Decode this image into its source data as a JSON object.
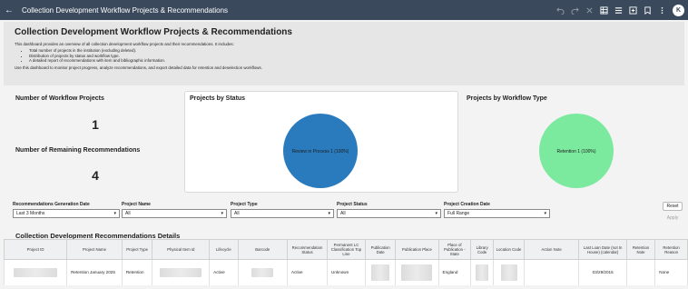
{
  "header": {
    "back_glyph": "←",
    "title": "Collection Development Workflow Projects & Recommendations",
    "avatar_initial": "K"
  },
  "intro": {
    "heading": "Collection Development Workflow Projects & Recommendations",
    "lead": "This dashboard provides an overview of all collection development workflow projects and their recommendations. It includes:",
    "bullets": [
      "Total number of projects in the institution (excluding deleted).",
      "Distribution of projects by status and workflow type.",
      "A detailed report of recommendations with item and bibliographic information."
    ],
    "footer": "Use this dashboard to monitor project progress, analyze recommendations, and export detailed data for retention and deselection workflows."
  },
  "kpis": {
    "projects_title": "Number of Workflow Projects",
    "projects_value": "1",
    "remaining_title": "Number of Remaining Recommendations",
    "remaining_value": "4"
  },
  "status_chart": {
    "title": "Projects by Status",
    "chart_data": {
      "type": "pie",
      "categories": [
        "Review in Process"
      ],
      "values": [
        1
      ],
      "labels": [
        "Review in Process 1 (100%)"
      ],
      "colors": [
        "#2a7bbd"
      ]
    }
  },
  "type_chart": {
    "title": "Projects by Workflow Type",
    "chart_data": {
      "type": "pie",
      "categories": [
        "Retention"
      ],
      "values": [
        1
      ],
      "labels": [
        "Retention 1 (100%)"
      ],
      "colors": [
        "#7bea9f"
      ]
    }
  },
  "filters": {
    "generation_date": {
      "label": "Recommendations Generation Date",
      "value": "Last 3 Months"
    },
    "project_name": {
      "label": "Project Name",
      "value": "All"
    },
    "project_type": {
      "label": "Project Type",
      "value": "All"
    },
    "project_status": {
      "label": "Project Status",
      "value": "All"
    },
    "creation_date": {
      "label": "Project Creation Date",
      "value": "Full Range"
    },
    "caret": "▾",
    "reset_label": "Reset",
    "apply_label": "Apply"
  },
  "details": {
    "title": "Collection Development Recommendations Details",
    "columns": [
      "Project ID",
      "Project Name",
      "Project Type",
      "Physical Item Id",
      "Lifecycle",
      "Barcode",
      "Recommendation Status",
      "Permanent LC Classification Top Line",
      "Publication Date",
      "Publication Place",
      "Place of Publication - State",
      "Library Code",
      "Location Code",
      "Action Note",
      "Last Loan Date (not In House) (calendar)",
      "Retention Note",
      "Retention Reason"
    ],
    "row": {
      "project_name": "Retention January 2025",
      "project_type": "Retention",
      "lifecycle": "Active",
      "recommendation_status": "Active",
      "lc_top_line": "Unknown",
      "publication_state": "England",
      "last_loan_date": "03/29/2015",
      "retention_reason": "None"
    }
  },
  "colors": {
    "header_bg": "#3a4a5c",
    "status_pie": "#2a7bbd",
    "type_pie": "#7bea9f"
  }
}
